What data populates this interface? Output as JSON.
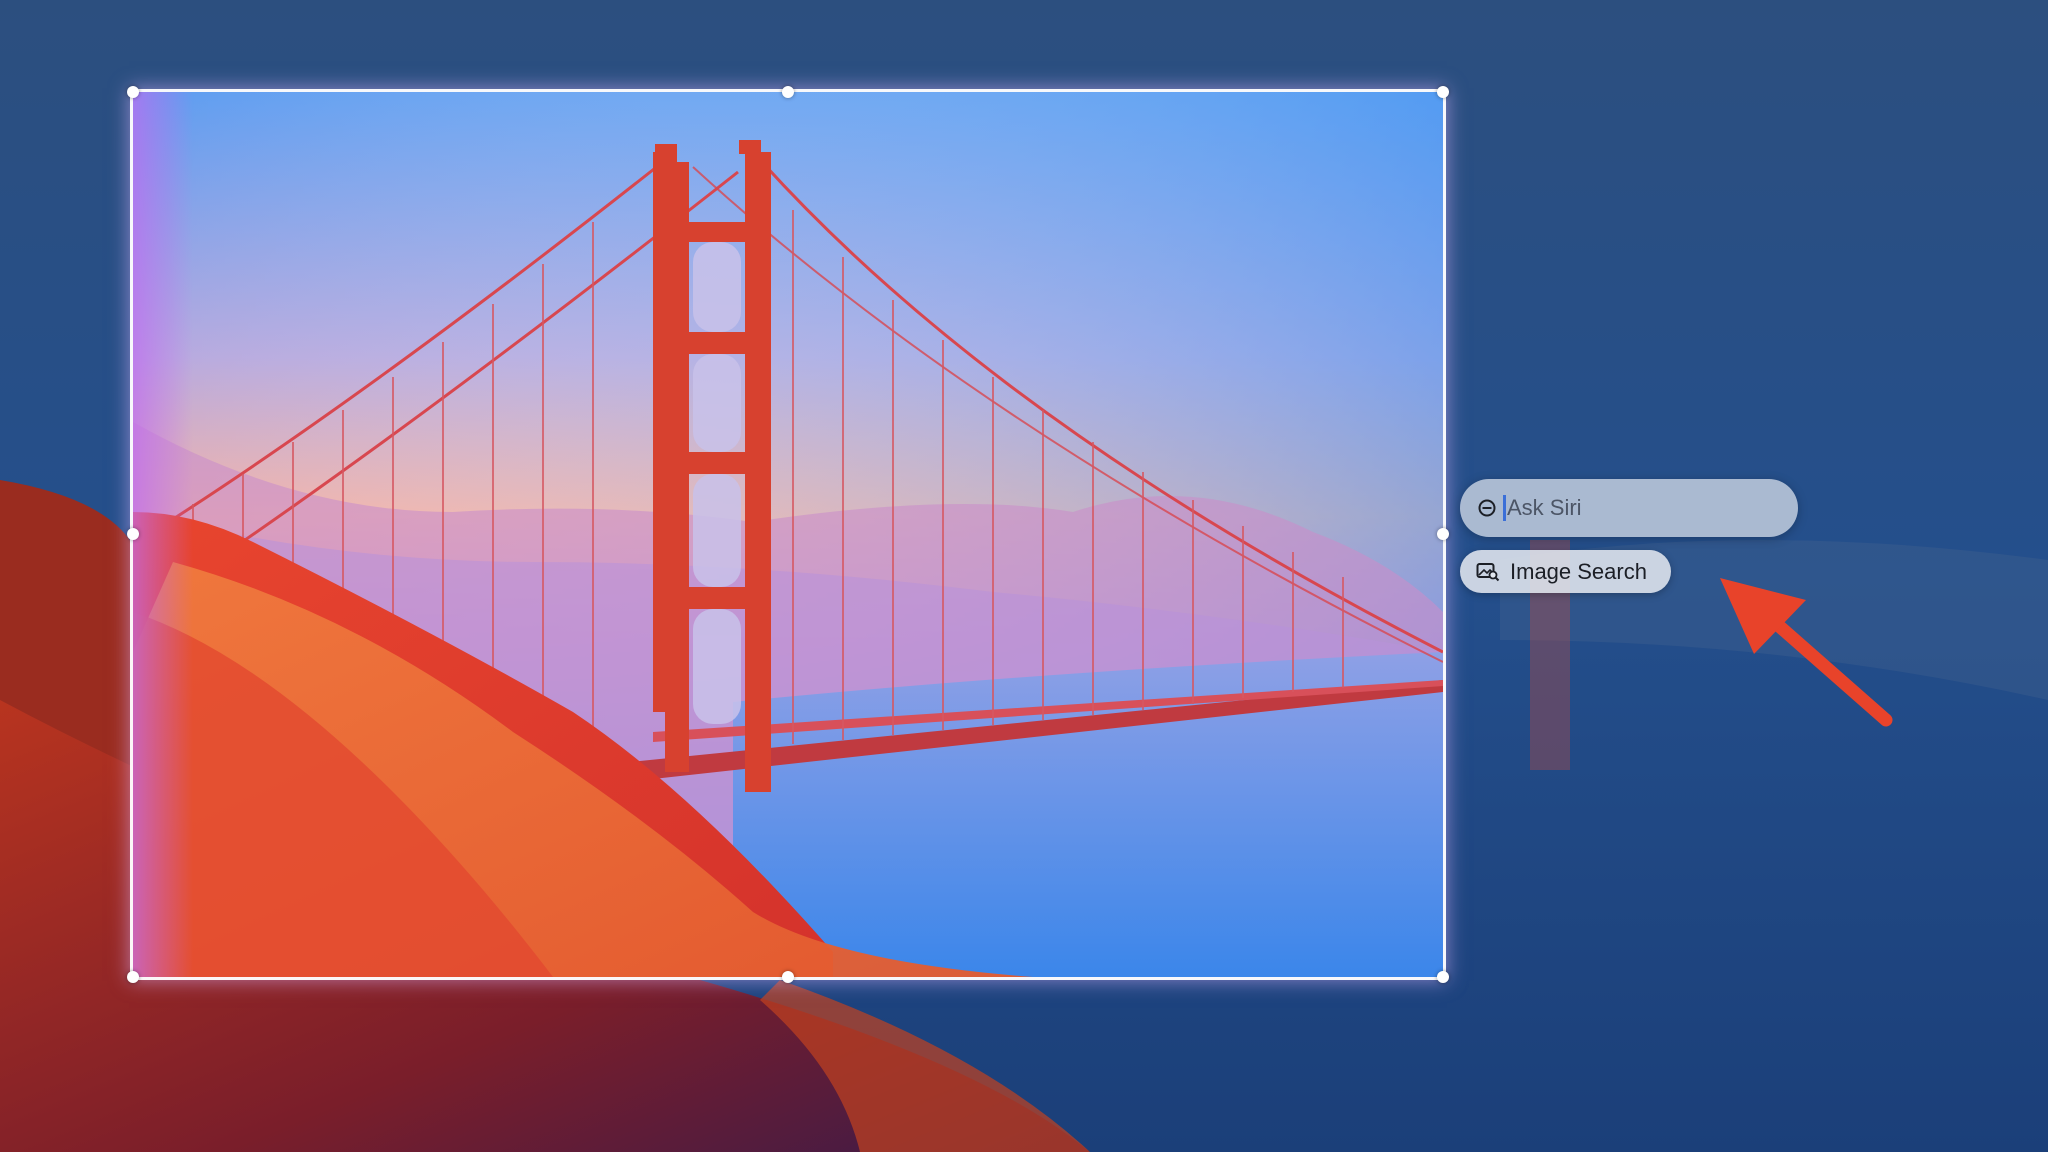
{
  "siri": {
    "placeholder": "Ask Siri",
    "icon": "siri-icon"
  },
  "image_search": {
    "label": "Image Search",
    "icon": "image-search-icon"
  },
  "annotation": {
    "color": "#e8432a"
  }
}
